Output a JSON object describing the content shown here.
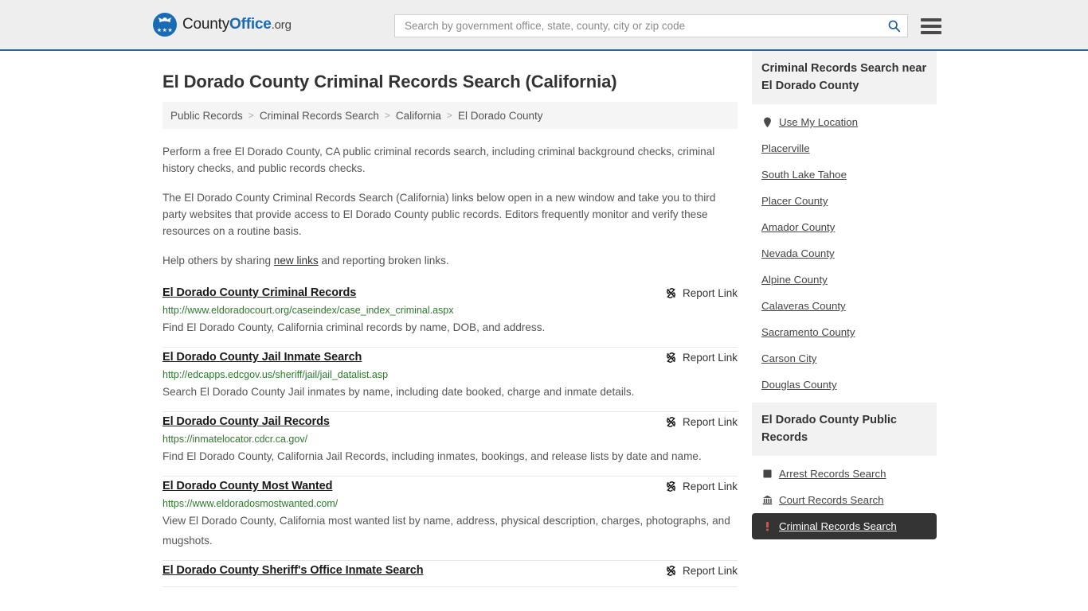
{
  "header": {
    "logo": {
      "part1": "County",
      "part2": "Office",
      "part3": ".org",
      "stars": "★★★"
    },
    "search": {
      "placeholder": "Search by government office, state, county, city or zip code",
      "value": ""
    },
    "search_icon": "search-icon",
    "menu_icon": "hamburger-menu-icon"
  },
  "main": {
    "title": "El Dorado County Criminal Records Search (California)",
    "breadcrumb": [
      {
        "label": "Public Records"
      },
      {
        "label": "Criminal Records Search"
      },
      {
        "label": "California"
      },
      {
        "label": "El Dorado County"
      }
    ],
    "breadcrumb_separator": ">",
    "intro": {
      "p1": "Perform a free El Dorado County, CA public criminal records search, including criminal background checks, criminal history checks, and public records checks.",
      "p2": "The El Dorado County Criminal Records Search (California) links below open in a new window and take you to third party websites that provide access to El Dorado County public records. Editors frequently monitor and verify these resources on a routine basis.",
      "p3_before": "Help others by sharing ",
      "p3_link": "new links",
      "p3_after": " and reporting broken links."
    },
    "report_link_label": "Report Link",
    "results": [
      {
        "title": "El Dorado County Criminal Records",
        "url": "http://www.eldoradocourt.org/caseindex/case_index_criminal.aspx",
        "description": "Find El Dorado County, California criminal records by name, DOB, and address."
      },
      {
        "title": "El Dorado County Jail Inmate Search",
        "url": "http://edcapps.edcgov.us/sheriff/jail/jail_datalist.asp",
        "description": "Search El Dorado County Jail inmates by name, including date booked, charge and inmate details."
      },
      {
        "title": "El Dorado County Jail Records",
        "url": "https://inmatelocator.cdcr.ca.gov/",
        "description": "Find El Dorado County, California Jail Records, including inmates, bookings, and release lists by date and name."
      },
      {
        "title": "El Dorado County Most Wanted",
        "url": "https://www.eldoradosmostwanted.com/",
        "description": "View El Dorado County, California most wanted list by name, address, physical description, charges, photographs, and mugshots."
      },
      {
        "title": "El Dorado County Sheriff's Office Inmate Search",
        "url": "",
        "description": ""
      }
    ]
  },
  "sidebar": {
    "nearby": {
      "header": "Criminal Records Search near El Dorado County",
      "use_my_location": "Use My Location",
      "location_icon": "map-pin-icon",
      "items": [
        {
          "label": "Placerville"
        },
        {
          "label": "South Lake Tahoe"
        },
        {
          "label": "Placer County"
        },
        {
          "label": "Amador County"
        },
        {
          "label": "Nevada County"
        },
        {
          "label": "Alpine County"
        },
        {
          "label": "Calaveras County"
        },
        {
          "label": "Sacramento County"
        },
        {
          "label": "Carson City"
        },
        {
          "label": "Douglas County"
        }
      ]
    },
    "public_records": {
      "header": "El Dorado County Public Records",
      "items": [
        {
          "label": "Arrest Records Search",
          "icon": "square-icon",
          "active": false
        },
        {
          "label": "Court Records Search",
          "icon": "courthouse-icon",
          "active": false
        },
        {
          "label": "Criminal Records Search",
          "icon": "exclamation-icon",
          "active": true
        }
      ]
    }
  },
  "colors": {
    "brand_blue": "#1a6bb5",
    "header_border": "#2a6496",
    "url_green": "#2d7a2d",
    "active_bg": "#343434",
    "header_bg": "#eeeeee"
  }
}
